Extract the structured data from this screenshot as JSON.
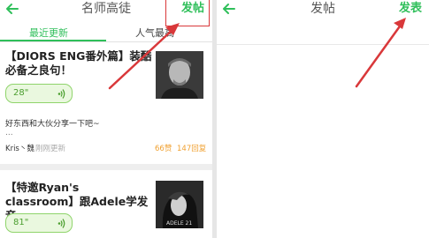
{
  "left_screen": {
    "title": "名师高徒",
    "post_button": "发帖",
    "tabs": [
      {
        "label": "最近更新",
        "active": true
      },
      {
        "label": "人气最高",
        "active": false
      }
    ],
    "posts": [
      {
        "title": "【DIORS ENG番外篇】装酷必备之良句！",
        "audio_duration": "28\"",
        "preview": "好东西和大伙分享一下吧~",
        "ellipsis": "...",
        "author": "Kris丶魏",
        "time": "刚刚更新",
        "likes": "66赞",
        "replies": "147回复",
        "thumb_icon": "portrait-photo-man"
      },
      {
        "title": "【特邀Ryan's classroom】跟Adele学发音",
        "audio_duration": "81\"",
        "thumb_caption": "ADELE 21",
        "thumb_icon": "portrait-photo-adele"
      }
    ]
  },
  "right_screen": {
    "title": "发帖",
    "publish_button": "发表"
  },
  "colors": {
    "accent": "#2fbf5a",
    "annotation": "#d9383a",
    "stat": "#f0a030"
  }
}
